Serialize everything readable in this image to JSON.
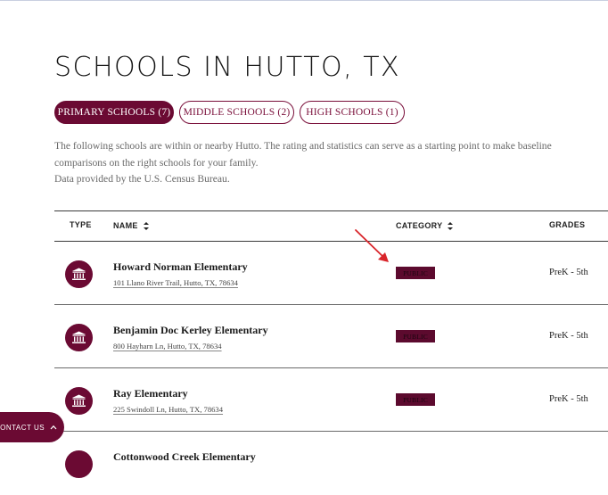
{
  "page": {
    "title": "SCHOOLS IN HUTTO, TX"
  },
  "tabs": [
    {
      "label": "PRIMARY SCHOOLS (7)",
      "active": true
    },
    {
      "label": "MIDDLE SCHOOLS (2)",
      "active": false
    },
    {
      "label": "HIGH SCHOOLS (1)",
      "active": false
    }
  ],
  "description": {
    "line1": "The following schools are within or nearby Hutto. The rating and statistics can serve as a starting point to make baseline comparisons on the right schools for your family.",
    "line2": "Data provided by the U.S. Census Bureau."
  },
  "table": {
    "headers": {
      "type": "TYPE",
      "name": "NAME",
      "category": "CATEGORY",
      "grades": "GRADES"
    },
    "rows": [
      {
        "name": "Howard Norman Elementary",
        "address": "101 Llano River Trail, Hutto, TX, 78634",
        "category": "PUBLIC",
        "grades": "PreK - 5th"
      },
      {
        "name": "Benjamin Doc Kerley Elementary",
        "address": "800 Hayharn Ln, Hutto, TX, 78634",
        "category": "PUBLIC",
        "grades": "PreK - 5th"
      },
      {
        "name": "Ray Elementary",
        "address": "225 Swindoll Ln, Hutto, TX, 78634",
        "category": "PUBLIC",
        "grades": "PreK - 5th"
      },
      {
        "name": "Cottonwood Creek Elementary",
        "address": "",
        "category": "",
        "grades": ""
      }
    ]
  },
  "contact": {
    "label": "CONTACT US"
  },
  "colors": {
    "accent": "#6b0a33",
    "annotation_arrow": "#d9252b"
  },
  "icons": {
    "school": "school-building-icon",
    "sort": "sort-arrows-icon",
    "chevron": "chevron-up-icon"
  }
}
